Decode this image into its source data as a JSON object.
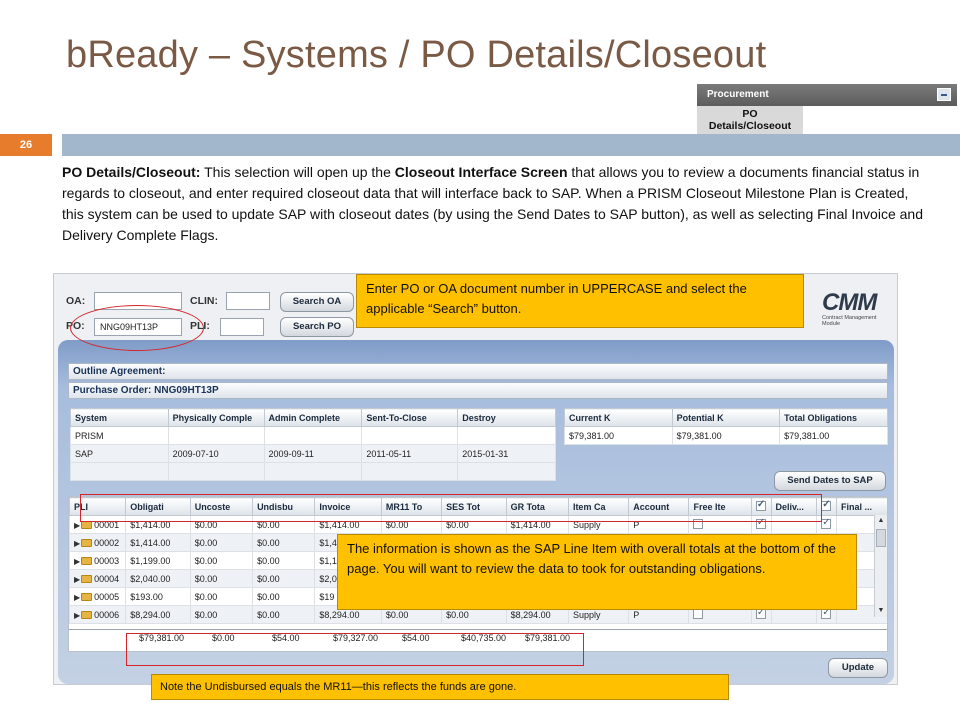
{
  "slide": {
    "title": "bReady – Systems / PO Details/Closeout",
    "page_number": "26"
  },
  "procurement_panel": {
    "header": "Procurement",
    "item_line1": "PO",
    "item_line2": "Details/Closeout"
  },
  "description": {
    "lead": "PO Details/Closeout:",
    "part1": "  This selection will open up the ",
    "bold1": "Closeout Interface Screen",
    "part2": " that allows you to review a documents financial status in regards to closeout, and enter required closeout data that will interface back to SAP. When a PRISM Closeout Milestone Plan is Created, this system can be used to update SAP with closeout dates (by using the Send Dates to SAP button), as well as selecting Final Invoice and Delivery Complete Flags."
  },
  "search": {
    "oa_label": "OA:",
    "po_label": "PO:",
    "oa_value": "",
    "po_value": "NNG09HT13P",
    "clin_label": "CLIN:",
    "pli_label": "PLI:",
    "search_oa_button": "Search OA",
    "search_po_button": "Search PO"
  },
  "logo": {
    "text": "CMM",
    "subtitle": "Contract Management Module"
  },
  "headers": {
    "outline_agreement": "Outline Agreement:",
    "purchase_order": "Purchase Order:  NNG09HT13P"
  },
  "dates_table": {
    "columns": [
      "System",
      "Physically Comple",
      "Admin Complete",
      "Sent-To-Close",
      "Destroy"
    ],
    "rows": [
      [
        "PRISM",
        "",
        "",
        "",
        ""
      ],
      [
        "SAP",
        "2009-07-10",
        "2009-09-11",
        "2011-05-11",
        "2015-01-31"
      ]
    ]
  },
  "totals_table": {
    "columns": [
      "Current K",
      "Potential K",
      "Total Obligations"
    ],
    "rows": [
      [
        "$79,381.00",
        "$79,381.00",
        "$79,381.00"
      ]
    ]
  },
  "send_dates_button": "Send Dates to SAP",
  "line_items": {
    "columns": [
      "PLI",
      "Obligati",
      "Uncoste",
      "Undisbu",
      "Invoice",
      "MR11 To",
      "SES Tot",
      "GR Tota",
      "Item Ca",
      "Account",
      "Free Ite",
      "",
      "Deliv...",
      "",
      "Final ..."
    ],
    "rows": [
      [
        "00001",
        "$1,414.00",
        "$0.00",
        "$0.00",
        "$1,414.00",
        "$0.00",
        "$0.00",
        "$1,414.00",
        "Supply",
        "P"
      ],
      [
        "00002",
        "$1,414.00",
        "$0.00",
        "$0.00",
        "$1,4",
        "",
        "",
        "",
        "",
        ""
      ],
      [
        "00003",
        "$1,199.00",
        "$0.00",
        "$0.00",
        "$1,1",
        "",
        "",
        "",
        "",
        ""
      ],
      [
        "00004",
        "$2,040.00",
        "$0.00",
        "$0.00",
        "$2,0",
        "",
        "",
        "",
        "",
        ""
      ],
      [
        "00005",
        "$193.00",
        "$0.00",
        "$0.00",
        "$19",
        "",
        "",
        "",
        "",
        ""
      ],
      [
        "00006",
        "$8,294.00",
        "$0.00",
        "$0.00",
        "$8,294.00",
        "$0.00",
        "$0.00",
        "$8,294.00",
        "Supply",
        "P"
      ]
    ],
    "totals": [
      "$79,381.00",
      "$0.00",
      "$54.00",
      "$79,327.00",
      "$54.00",
      "$40,735.00",
      "$79,381.00"
    ]
  },
  "update_button": "Update",
  "callouts": {
    "enter_po": "Enter PO or OA document number in UPPERCASE and select the applicable “Search” button.",
    "info": "The information is shown as the SAP Line Item with overall totals at the bottom of the page.  You will want to review the data to took for outstanding obligations.",
    "note": "Note the Undisbursed equals the MR11—this reflects the funds are gone."
  },
  "colors": {
    "title": "#7a5a45",
    "accent_bar": "#a2b7cc",
    "page_number_bg": "#e87c2d",
    "callout": "#ffc000",
    "highlight": "#d6252a"
  }
}
